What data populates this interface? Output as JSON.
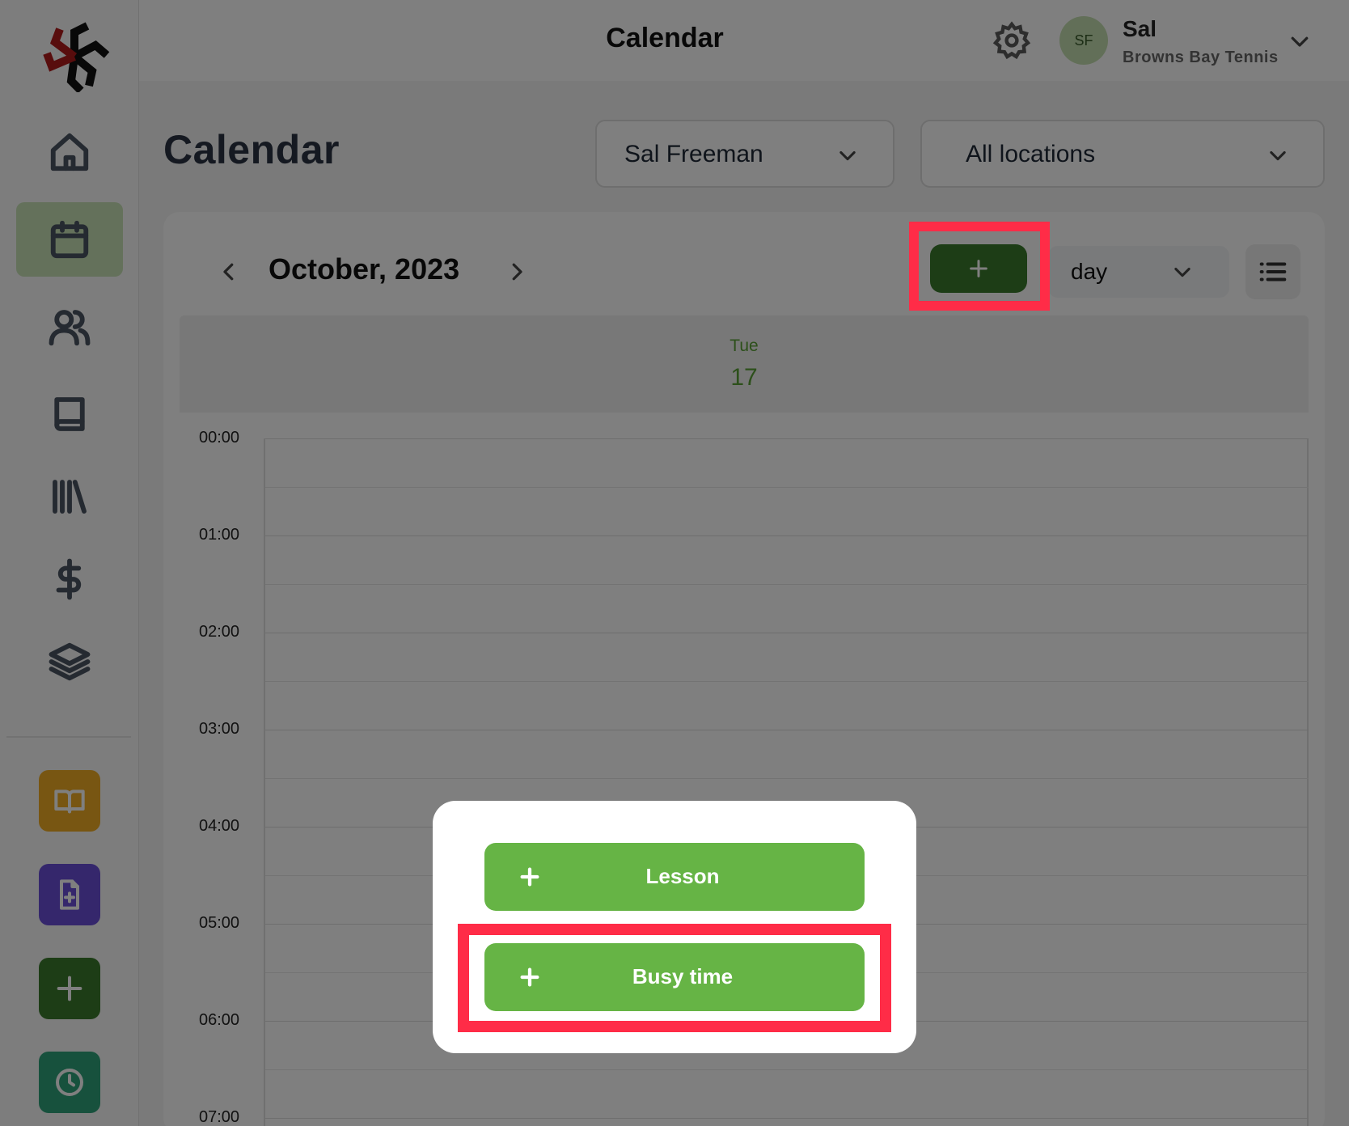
{
  "app": {
    "title": "Calendar",
    "user": {
      "initials": "SF",
      "name": "Sal",
      "organization": "Browns Bay Tennis"
    }
  },
  "sidebar": {
    "logo": "club-logo",
    "items": [
      {
        "icon": "home-icon",
        "active": false
      },
      {
        "icon": "calendar-icon",
        "active": true
      },
      {
        "icon": "users-icon",
        "active": false
      },
      {
        "icon": "book-icon",
        "active": false
      },
      {
        "icon": "library-icon",
        "active": false
      },
      {
        "icon": "dollar-icon",
        "active": false
      },
      {
        "icon": "layers-icon",
        "active": false
      }
    ],
    "quick_actions": [
      {
        "icon": "open-book-icon",
        "color": "#f0ad25"
      },
      {
        "icon": "file-plus-icon",
        "color": "#6b4fd8"
      },
      {
        "icon": "plus-icon",
        "color": "#3a7a2c"
      },
      {
        "icon": "clock-icon",
        "color": "#2fa37a"
      }
    ]
  },
  "page": {
    "title": "Calendar",
    "coach_filter": "Sal Freeman",
    "location_filter": "All locations"
  },
  "calendar": {
    "month_label": "October, 2023",
    "view": "day",
    "day_name": "Tue",
    "day_number": "17",
    "times": [
      "00:00",
      "01:00",
      "02:00",
      "03:00",
      "04:00",
      "05:00",
      "06:00",
      "07:00"
    ]
  },
  "modal": {
    "lesson_label": "Lesson",
    "busy_time_label": "Busy time"
  },
  "colors": {
    "primary_green": "#3a7a2c",
    "modal_button_green": "#66b445",
    "highlight_red": "#ff2c47",
    "day_header_green": "#5aa037"
  }
}
